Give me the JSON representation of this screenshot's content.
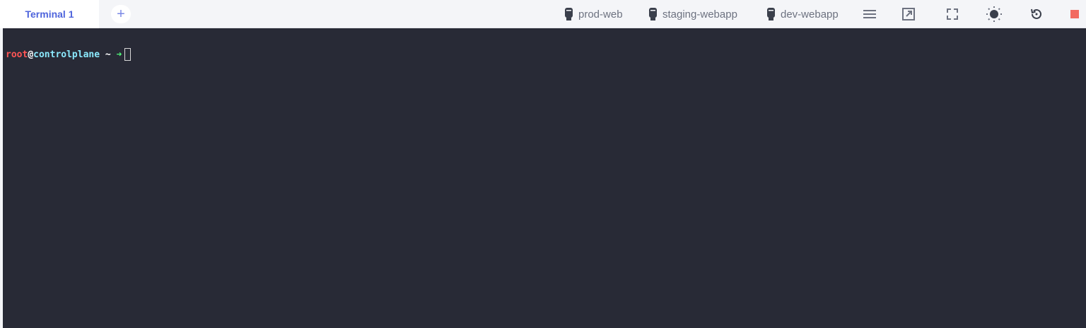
{
  "tabs": [
    {
      "label": "Terminal 1",
      "active": true
    }
  ],
  "add_tab_icon": "plus-icon",
  "hosts": [
    {
      "label": "prod-web",
      "icon": "server-icon"
    },
    {
      "label": "staging-webapp",
      "icon": "server-icon"
    },
    {
      "label": "dev-webapp",
      "icon": "server-icon"
    }
  ],
  "toolbar_icons": [
    "menu-icon",
    "open-external-icon",
    "fullscreen-icon",
    "theme-brightness-icon",
    "restart-icon",
    "stop-icon"
  ],
  "prompt": {
    "user": "root",
    "at": "@",
    "host": "controlplane",
    "path": " ~ ",
    "arrow": "➜"
  },
  "colors": {
    "terminal_bg": "#282a36",
    "user": "#ff5555",
    "host": "#8be9fd",
    "arrow": "#50fa7b",
    "tab_text": "#4e64dc",
    "stop": "#f26b61"
  }
}
